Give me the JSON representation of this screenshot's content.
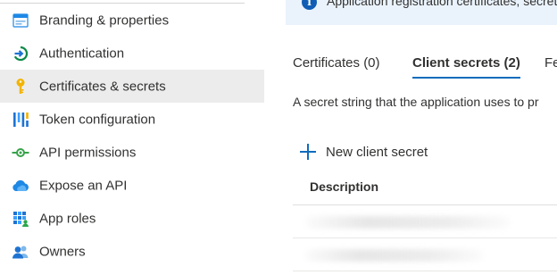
{
  "sidebar": {
    "items": [
      {
        "label": "Branding & properties",
        "icon": "branding-icon",
        "selected": false
      },
      {
        "label": "Authentication",
        "icon": "authentication-icon",
        "selected": false
      },
      {
        "label": "Certificates & secrets",
        "icon": "key-icon",
        "selected": true
      },
      {
        "label": "Token configuration",
        "icon": "token-configuration-icon",
        "selected": false
      },
      {
        "label": "API permissions",
        "icon": "api-permissions-icon",
        "selected": false
      },
      {
        "label": "Expose an API",
        "icon": "cloud-icon",
        "selected": false
      },
      {
        "label": "App roles",
        "icon": "app-roles-icon",
        "selected": false
      },
      {
        "label": "Owners",
        "icon": "owners-icon",
        "selected": false
      }
    ]
  },
  "banner": {
    "icon": "info-icon",
    "text": "Application registration certificates, secrets"
  },
  "tabs": [
    {
      "label": "Certificates (0)",
      "active": false
    },
    {
      "label": "Client secrets (2)",
      "active": true
    },
    {
      "label": "Fe",
      "active": false
    }
  ],
  "description": "A secret string that the application uses to pr",
  "toolbar": {
    "new_secret_label": "New client secret",
    "new_secret_icon": "plus-icon"
  },
  "table": {
    "columns": [
      "Description"
    ],
    "rows": [
      {
        "description": ""
      },
      {
        "description": ""
      }
    ]
  },
  "colors": {
    "accent": "#0f6cbd",
    "selected_bg": "#ececec",
    "banner_bg": "#eaf3fc",
    "info_icon": "#0f5db4"
  }
}
